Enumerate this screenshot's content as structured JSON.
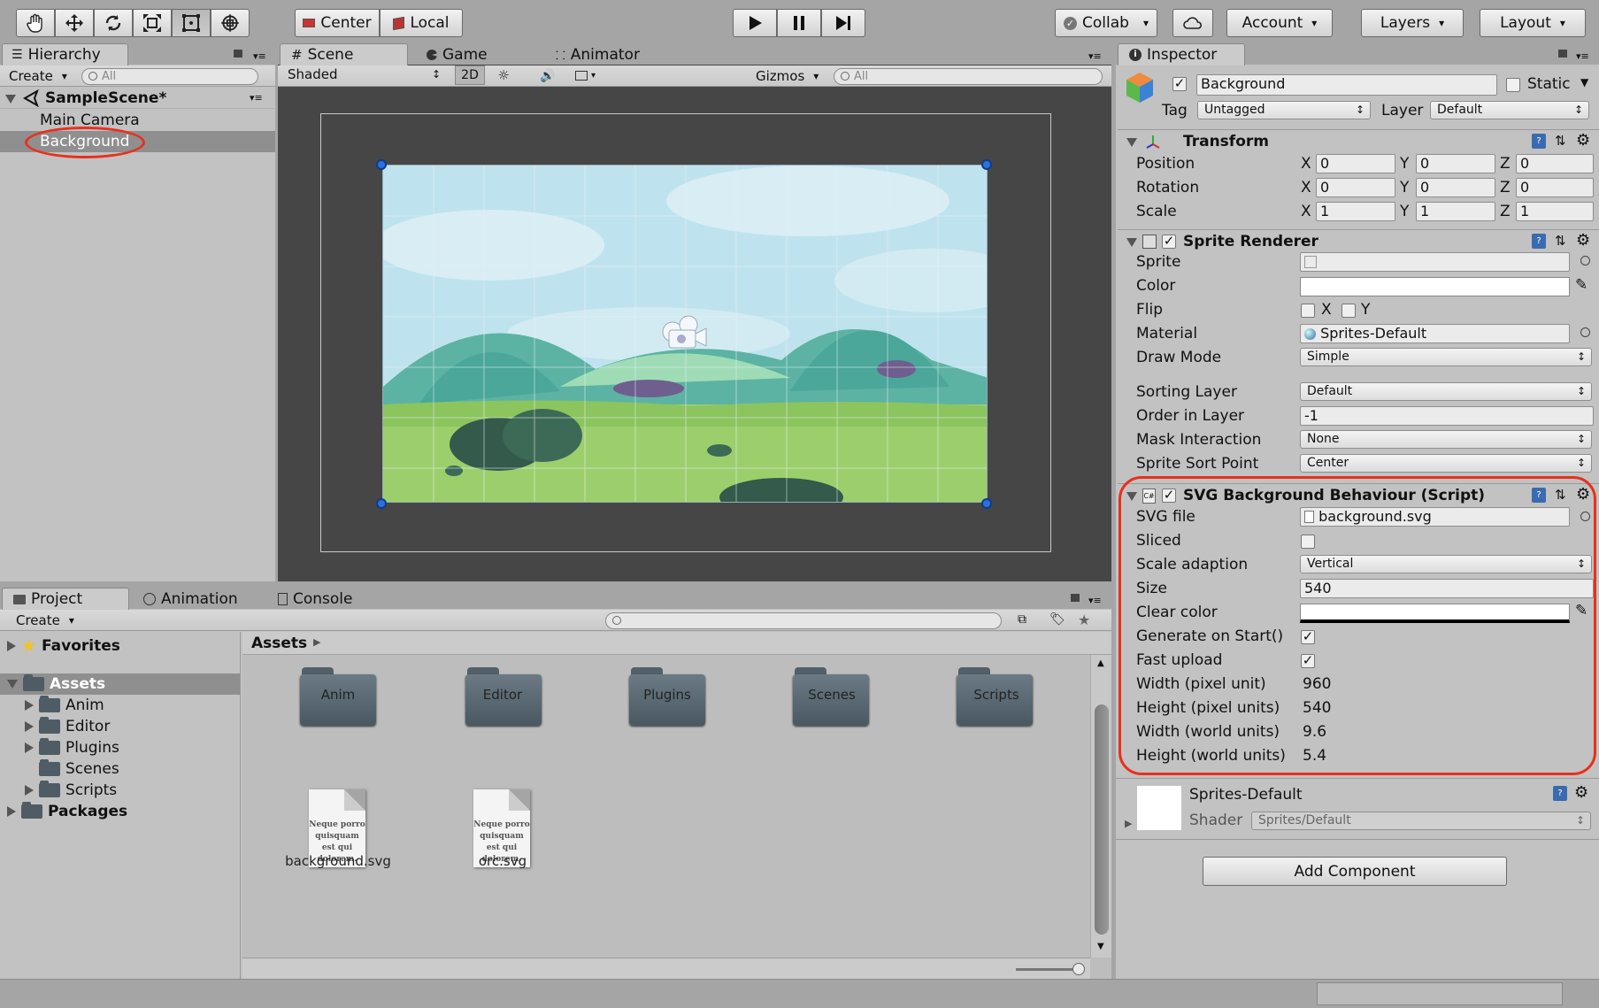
{
  "toolbar": {
    "pivot_center": "Center",
    "pivot_local": "Local",
    "collab": "Collab",
    "account": "Account",
    "layers": "Layers",
    "layout": "Layout"
  },
  "hierarchy": {
    "tab": "Hierarchy",
    "create": "Create",
    "search_placeholder": "All",
    "scene": "SampleScene*",
    "items": [
      "Main Camera",
      "Background"
    ],
    "selected": "Background"
  },
  "scene_view": {
    "tabs": [
      "Scene",
      "Game",
      "Animator"
    ],
    "shading": "Shaded",
    "mode_2d": "2D",
    "gizmos": "Gizmos",
    "search_placeholder": "All"
  },
  "project": {
    "tabs": [
      "Project",
      "Animation",
      "Console"
    ],
    "create": "Create",
    "favorites": "Favorites",
    "assets_root": "Assets",
    "tree": [
      "Anim",
      "Editor",
      "Plugins",
      "Scenes",
      "Scripts"
    ],
    "packages": "Packages",
    "breadcrumb": "Assets",
    "folders": [
      "Anim",
      "Editor",
      "Plugins",
      "Scenes",
      "Scripts"
    ],
    "files": [
      "background.svg",
      "orc.svg"
    ],
    "file_preview_text": "Neque porro quisquam est qui dolorem."
  },
  "inspector": {
    "tab": "Inspector",
    "object_name": "Background",
    "static_label": "Static",
    "tag_label": "Tag",
    "tag": "Untagged",
    "layer_label": "Layer",
    "layer": "Default",
    "transform": {
      "title": "Transform",
      "position_label": "Position",
      "rotation_label": "Rotation",
      "scale_label": "Scale",
      "axes": [
        "X",
        "Y",
        "Z"
      ],
      "position": [
        "0",
        "0",
        "0"
      ],
      "rotation": [
        "0",
        "0",
        "0"
      ],
      "scale": [
        "1",
        "1",
        "1"
      ]
    },
    "sprite_renderer": {
      "title": "Sprite Renderer",
      "sprite_label": "Sprite",
      "color_label": "Color",
      "flip_label": "Flip",
      "flip_x": "X",
      "flip_y": "Y",
      "material_label": "Material",
      "material": "Sprites-Default",
      "draw_mode_label": "Draw Mode",
      "draw_mode": "Simple",
      "sorting_layer_label": "Sorting Layer",
      "sorting_layer": "Default",
      "order_label": "Order in Layer",
      "order": "-1",
      "mask_label": "Mask Interaction",
      "mask": "None",
      "sort_point_label": "Sprite Sort Point",
      "sort_point": "Center"
    },
    "svg_behaviour": {
      "title": "SVG Background Behaviour (Script)",
      "svg_file_label": "SVG file",
      "svg_file": "background.svg",
      "sliced_label": "Sliced",
      "scale_adaption_label": "Scale adaption",
      "scale_adaption": "Vertical",
      "size_label": "Size",
      "size": "540",
      "clear_color_label": "Clear color",
      "generate_label": "Generate on Start()",
      "fast_upload_label": "Fast upload",
      "width_px_label": "Width (pixel unit)",
      "width_px": "960",
      "height_px_label": "Height (pixel units)",
      "height_px": "540",
      "width_world_label": "Width (world units)",
      "width_world": "9.6",
      "height_world_label": "Height (world units)",
      "height_world": "5.4"
    },
    "material": {
      "name": "Sprites-Default",
      "shader_label": "Shader",
      "shader": "Sprites/Default"
    },
    "add_component": "Add Component"
  },
  "colors": {
    "accent_selection": "#8f8f8f",
    "highlight_circle": "#e8301c",
    "handle_blue": "#2d6fe0"
  }
}
